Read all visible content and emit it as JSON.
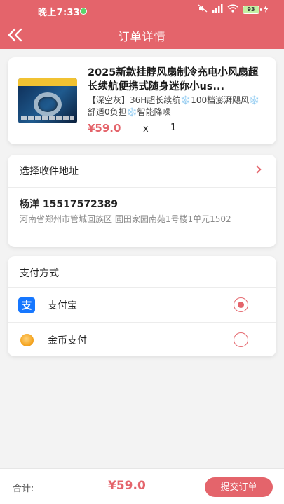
{
  "colors": {
    "accent": "#e4646b",
    "alipay": "#1677ff",
    "coin": "#f5a623"
  },
  "status_bar": {
    "time": "晚上7:33",
    "battery": "93",
    "icons": [
      "app-notification-icon",
      "mute-icon",
      "signal-icon",
      "wifi-icon",
      "battery-icon",
      "charging-icon"
    ]
  },
  "header": {
    "title": "订单详情",
    "back_icon": "double-chevron-left-icon"
  },
  "product": {
    "image_icon": "product-image",
    "title": "2025新款挂脖风扇制冷充电小风扇超长续航便携式随身迷你小us...",
    "spec": "【深空灰】36H超长续航❄️100档澎湃飓风❄️舒适0负担❄️智能降噪",
    "price": "¥59.0",
    "x": "x",
    "quantity": "1"
  },
  "address": {
    "select_label": "选择收件地址",
    "chevron_icon": "chevron-right-icon",
    "receiver": "杨洋 15517572389",
    "detail": "河南省郑州市管城回族区 圃田家园南苑1号楼1单元1502"
  },
  "payment": {
    "title": "支付方式",
    "methods": [
      {
        "label": "支付宝",
        "icon": "alipay-icon",
        "glyph": "支",
        "selected": true
      },
      {
        "label": "金币支付",
        "icon": "coin-icon",
        "selected": false
      }
    ]
  },
  "footer": {
    "total_label": "合计:",
    "total_value": "¥59.0",
    "submit_label": "提交订单"
  }
}
